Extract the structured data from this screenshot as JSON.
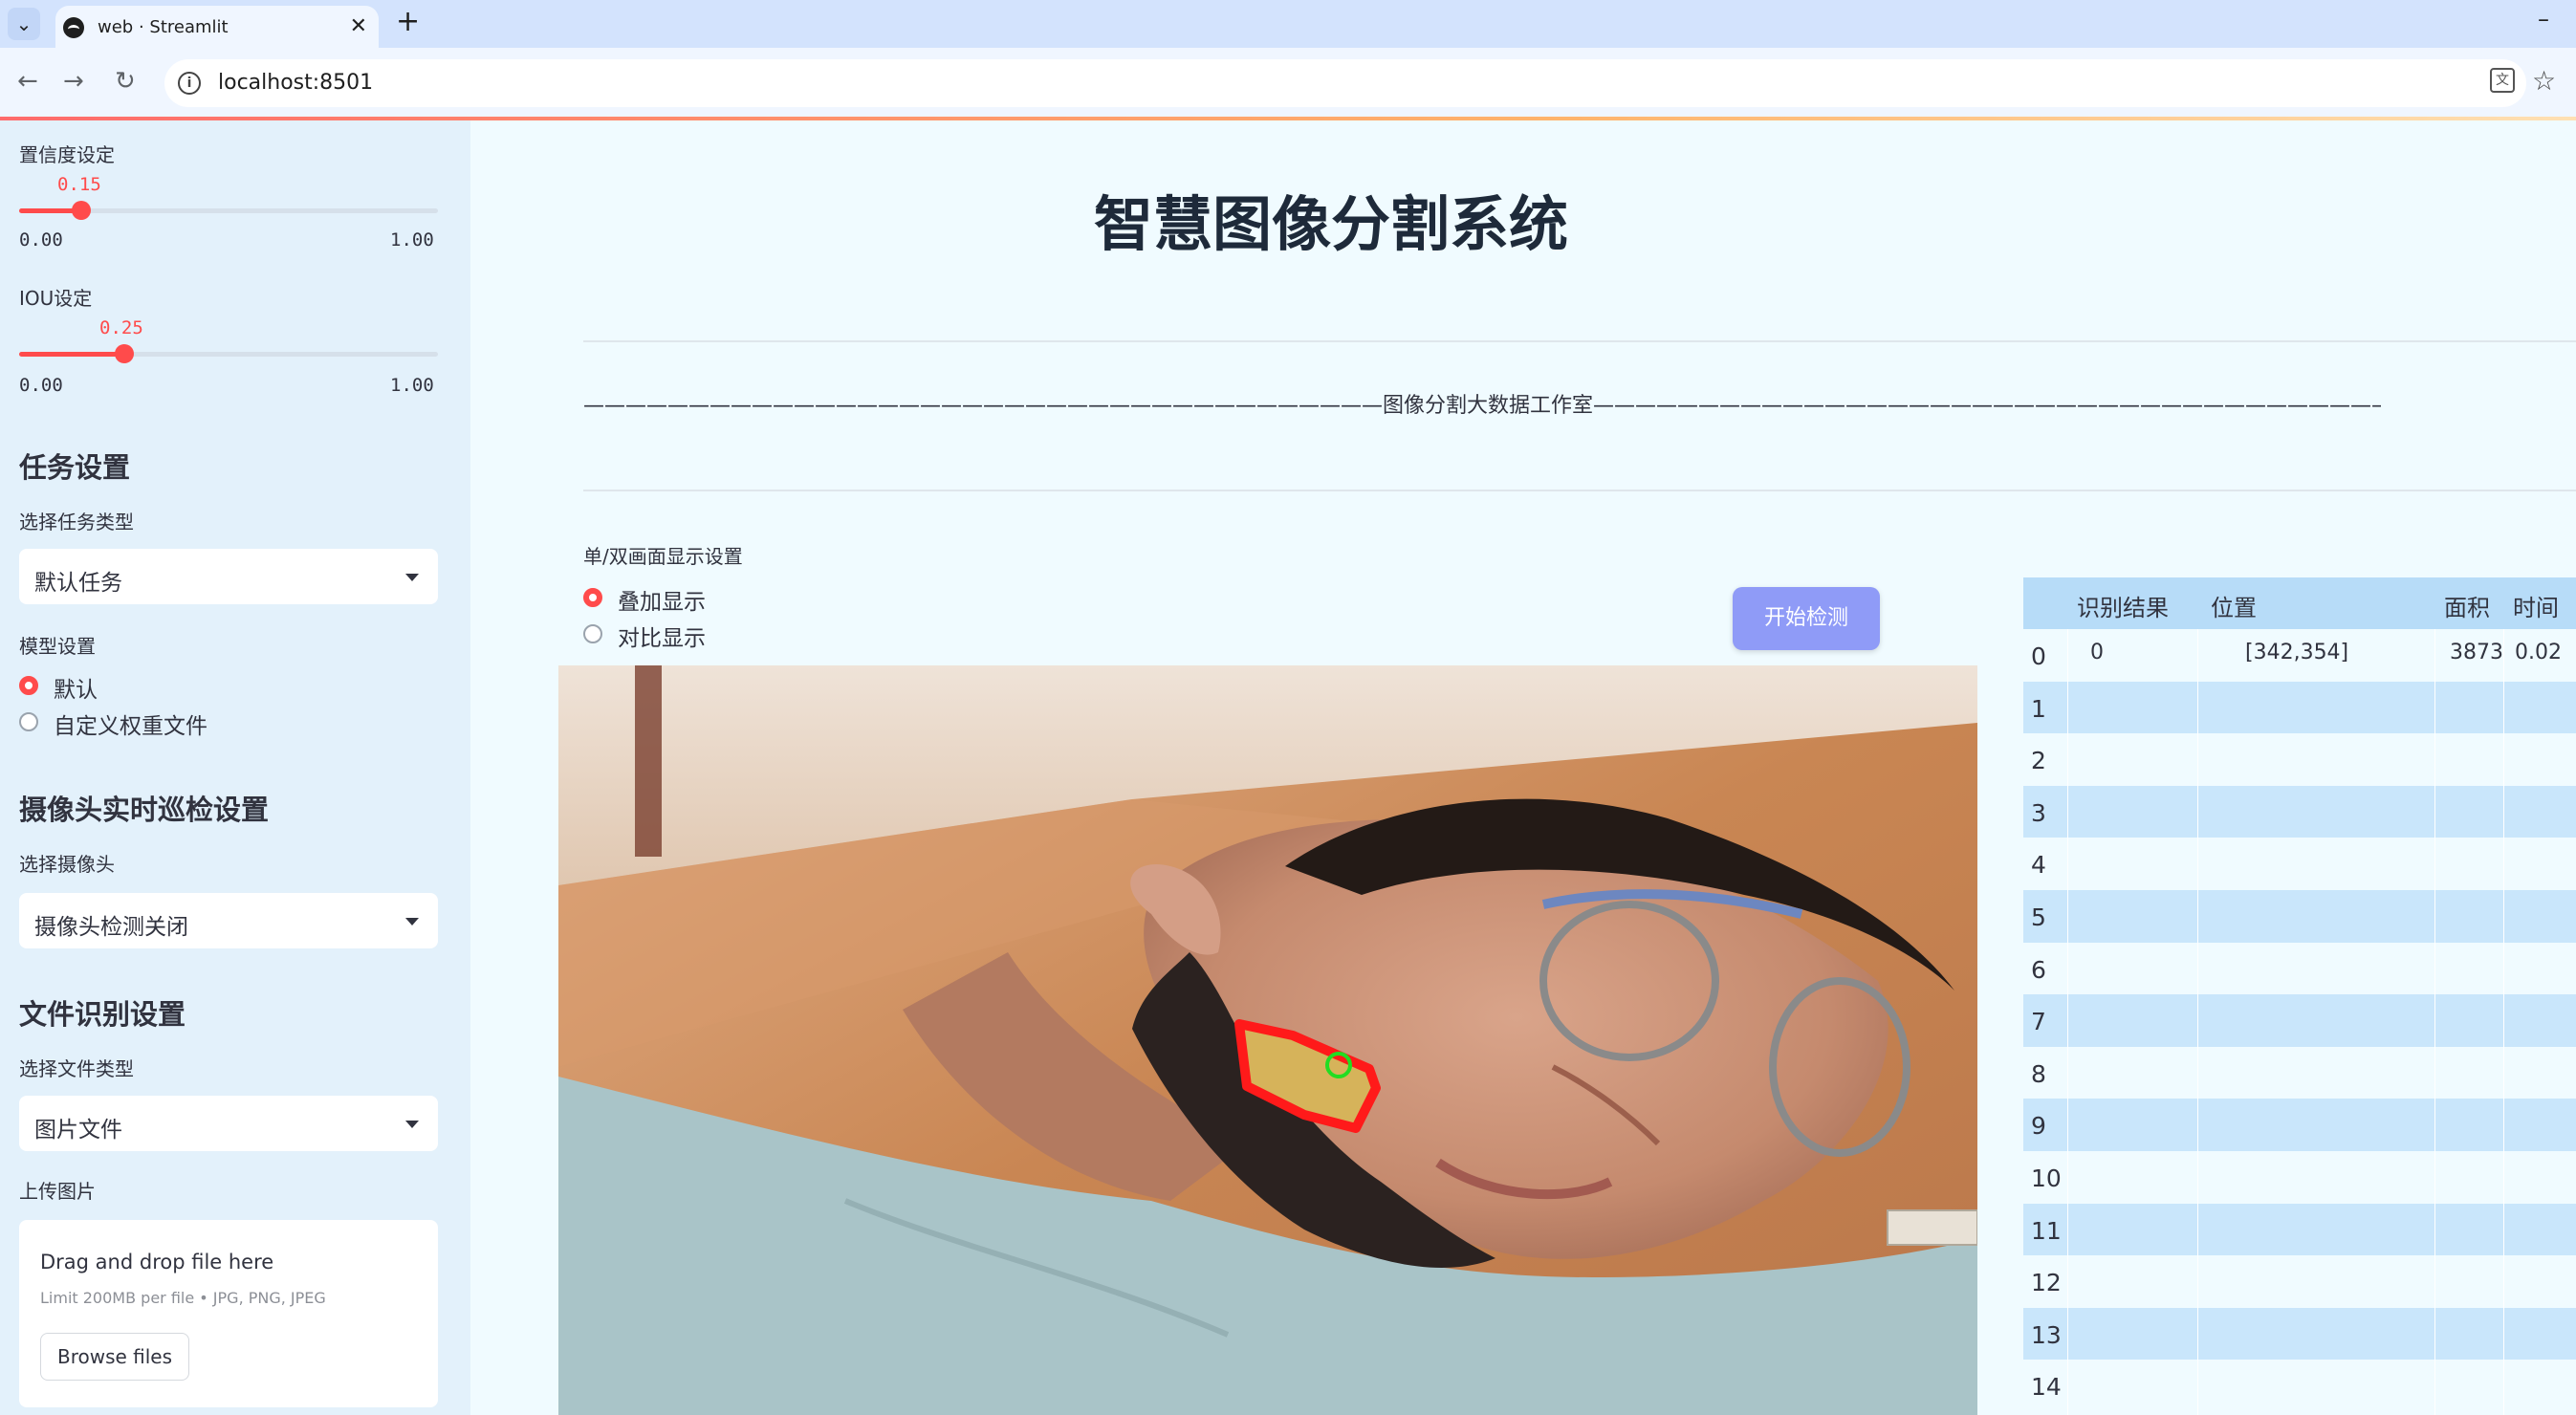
{
  "browser": {
    "tab_title": "web · Streamlit",
    "url": "localhost:8501"
  },
  "sidebar": {
    "confidence": {
      "label": "置信度设定",
      "value": "0.15",
      "min": "0.00",
      "max": "1.00",
      "fraction": 0.15
    },
    "iou": {
      "label": "IOU设定",
      "value": "0.25",
      "min": "0.00",
      "max": "1.00",
      "fraction": 0.25
    },
    "task": {
      "heading": "任务设置",
      "select_label": "选择任务类型",
      "selected": "默认任务"
    },
    "model": {
      "label": "模型设置",
      "options": [
        "默认",
        "自定义权重文件"
      ],
      "selected_index": 0
    },
    "camera": {
      "heading": "摄像头实时巡检设置",
      "select_label": "选择摄像头",
      "selected": "摄像头检测关闭"
    },
    "file": {
      "heading": "文件识别设置",
      "select_label": "选择文件类型",
      "selected": "图片文件"
    },
    "upload": {
      "label": "上传图片",
      "title": "Drag and drop file here",
      "limit": "Limit 200MB per file • JPG, PNG, JPEG",
      "button": "Browse files"
    }
  },
  "main": {
    "title": "智慧图像分割系统",
    "subtitle": "——————————————————————————————————————图像分割大数据工作室——————————————————————————————————————",
    "display_label": "单/双画面显示设置",
    "display_options": [
      "叠加显示",
      "对比显示"
    ],
    "display_selected_index": 0,
    "start_button": "开始检测"
  },
  "results_table": {
    "headers": [
      "识别结果",
      "位置",
      "面积",
      "时间"
    ],
    "rows": [
      {
        "index": "0",
        "result": "0",
        "position": "[342,354]",
        "area": "3873",
        "time": "0.02"
      },
      {
        "index": "1"
      },
      {
        "index": "2"
      },
      {
        "index": "3"
      },
      {
        "index": "4"
      },
      {
        "index": "5"
      },
      {
        "index": "6"
      },
      {
        "index": "7"
      },
      {
        "index": "8"
      },
      {
        "index": "9"
      },
      {
        "index": "10"
      },
      {
        "index": "11"
      },
      {
        "index": "12"
      },
      {
        "index": "13"
      },
      {
        "index": "14"
      }
    ]
  },
  "colors": {
    "accent": "#ff4b4b",
    "button": "#8f9bf7",
    "sidebar_bg": "#e3f1fb",
    "table_header": "#b7dcf8",
    "mask_outline": "#ff1a1a",
    "mask_fill": "#d6b35a",
    "center_marker": "#22dd22"
  }
}
